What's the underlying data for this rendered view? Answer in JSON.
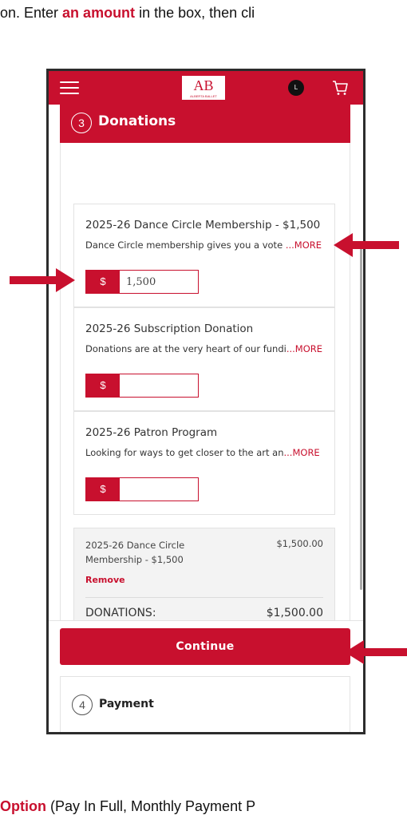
{
  "instructions": {
    "top_pre": "on. Enter ",
    "top_highlight": "an amount",
    "top_post": " in the box, then cli",
    "bottom_highlight": "Option",
    "bottom_post": " (Pay In Full, Monthly Payment P"
  },
  "header": {
    "logo_text": "AB",
    "logo_subtext": "ALBERTA BALLET",
    "avatar_initial": "L",
    "icons": [
      "hamburger-icon",
      "cart-icon"
    ]
  },
  "section": {
    "step": "3",
    "title": "Donations"
  },
  "donations": [
    {
      "title": "2025-26 Dance Circle Membership - $1,500",
      "desc": "Dance Circle membership gives you a vote ",
      "more": "...MORE",
      "currency": "$",
      "amount": "1,500"
    },
    {
      "title": "2025-26 Subscription Donation",
      "desc": "Donations are at the very heart of our fundi",
      "more": "...MORE",
      "currency": "$",
      "amount": ""
    },
    {
      "title": "2025-26 Patron Program",
      "desc": "Looking for ways to get closer to the art an",
      "more": "...MORE",
      "currency": "$",
      "amount": ""
    }
  ],
  "summary": {
    "item": "2025-26 Dance Circle Membership - $1,500",
    "price": "$1,500.00",
    "remove": "Remove",
    "label": "DONATIONS:",
    "total": "$1,500.00"
  },
  "continue_label": "Continue",
  "payment": {
    "step": "4",
    "title": "Payment"
  },
  "colors": {
    "brand_red": "#c8102e"
  }
}
